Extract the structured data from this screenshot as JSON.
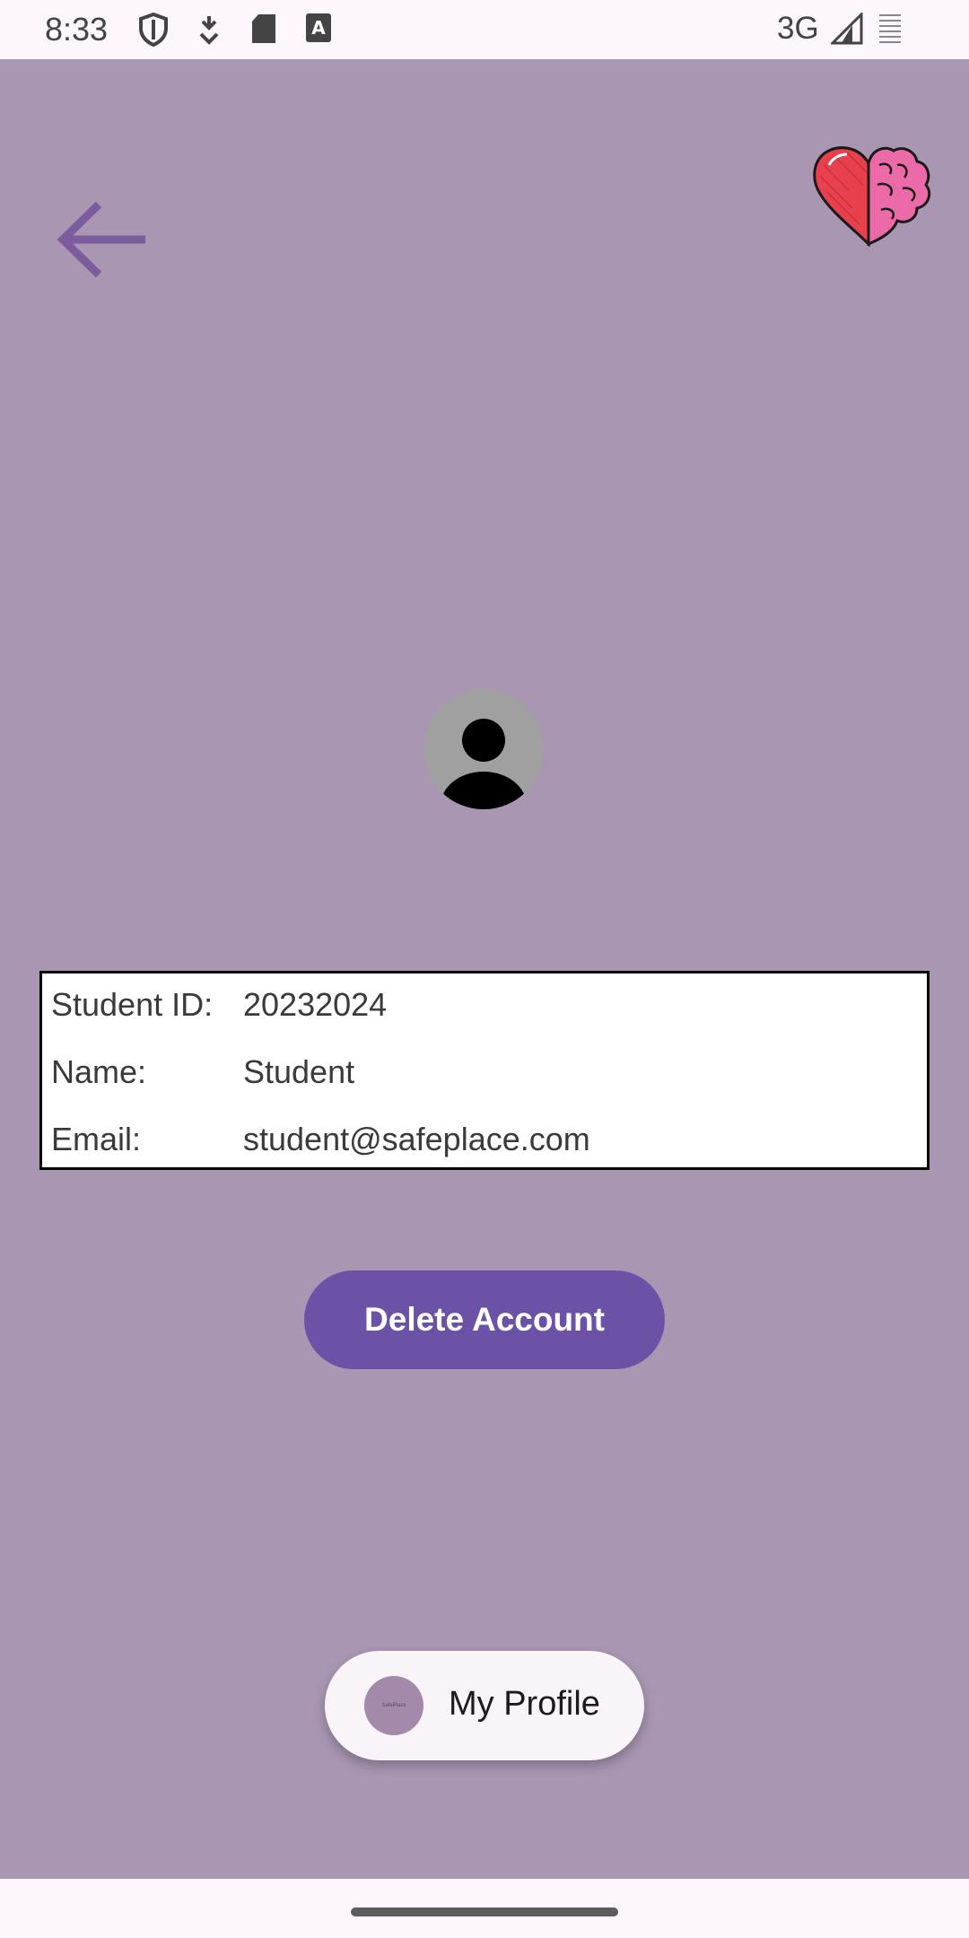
{
  "status_bar": {
    "time": "8:33",
    "network": "3G",
    "icons": [
      "shield-icon",
      "download-icon",
      "sd-card-icon",
      "keyboard-a-icon",
      "signal-icon",
      "battery-icon"
    ]
  },
  "header": {
    "back_icon": "arrow-left-icon",
    "logo_icon": "heart-brain-logo-icon"
  },
  "profile": {
    "avatar_icon": "person-avatar-icon",
    "rows": [
      {
        "label": "Student ID:",
        "value": "20232024"
      },
      {
        "label": "Name:",
        "value": "Student"
      },
      {
        "label": "Email:",
        "value": "student@safeplace.com"
      }
    ]
  },
  "actions": {
    "delete_label": "Delete Account"
  },
  "bottom_pill": {
    "logo_text": "SafePlace",
    "label": "My Profile"
  },
  "colors": {
    "background": "#a896b2",
    "accent": "#6b52a6",
    "back_arrow": "#7c5c9c"
  }
}
